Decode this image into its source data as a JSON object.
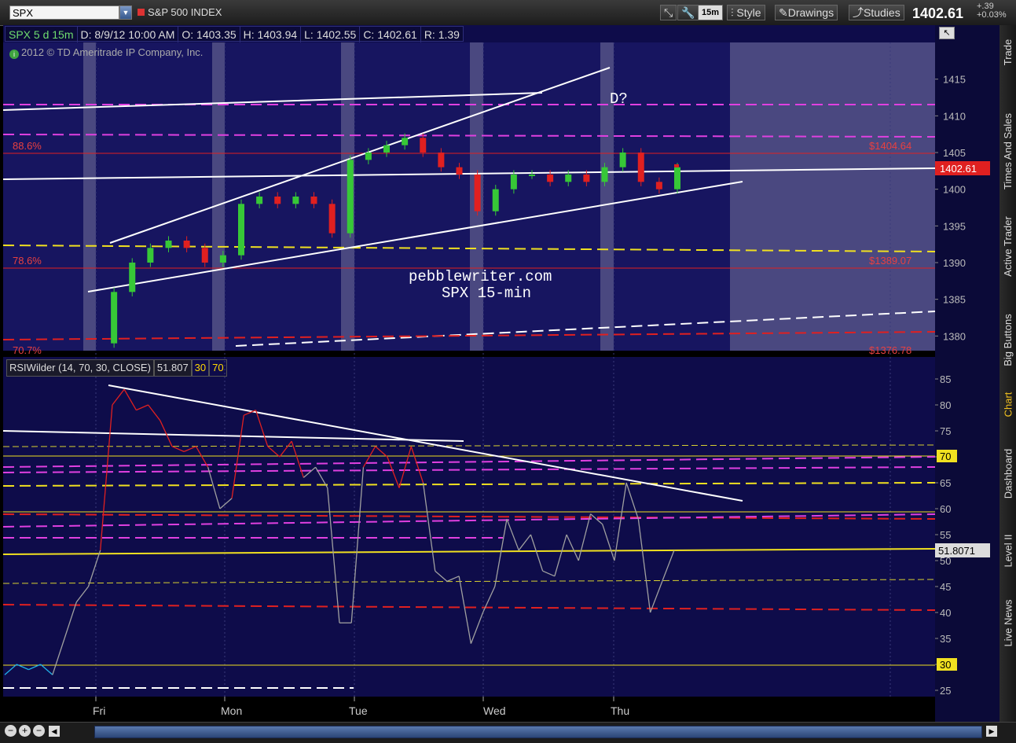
{
  "toolbar": {
    "symbol": "SPX",
    "description": "S&P 500 INDEX",
    "timeframe": "15m",
    "style_label": "Style",
    "drawings_label": "Drawings",
    "studies_label": "Studies",
    "last_price": "1402.61",
    "net_change": "+.39",
    "pct_change": "+0.03%"
  },
  "header": {
    "symbol_period": "SPX 5 d 15m",
    "date": "D: 8/9/12 10:00 AM",
    "open": "O: 1403.35",
    "high": "H: 1403.94",
    "low": "L: 1402.55",
    "close": "C: 1402.61",
    "range": "R: 1.39"
  },
  "copyright": "2012 © TD Ameritrade IP Company, Inc.",
  "annotations": {
    "d_question": "D?",
    "site": "pebblewriter.com",
    "subtitle": "SPX 15-min",
    "fib_886": "88.6%",
    "fib_786": "78.6%",
    "fib_707": "70.7%",
    "fib_886_price": "$1404.64",
    "fib_786_price": "$1389.07",
    "fib_707_price": "$1376.78"
  },
  "rsi_header": {
    "study": "RSIWilder (14, 70, 30, CLOSE)",
    "value": "51.807",
    "overbought": "30",
    "oversold": "70"
  },
  "price_axis": {
    "ticks": [
      "1415",
      "1410",
      "1405",
      "1400",
      "1395",
      "1390",
      "1385",
      "1380"
    ],
    "current_label": "1402.61"
  },
  "rsi_axis": {
    "ticks": [
      "85",
      "80",
      "75",
      "70",
      "65",
      "60",
      "55",
      "50",
      "45",
      "40",
      "35",
      "30",
      "25"
    ],
    "current_label": "51.8071",
    "level_70_label": "70",
    "level_30_label": "30"
  },
  "x_axis": {
    "days": [
      "Fri",
      "Mon",
      "Tue",
      "Wed",
      "Thu"
    ]
  },
  "side_tabs": [
    "Trade",
    "Times And Sales",
    "Active Trader",
    "Big Buttons",
    "Chart",
    "Dashboard",
    "Level II",
    "Live News"
  ],
  "colors": {
    "chart_bg": "#0e0c4a",
    "session_shade": "#4a4880",
    "up_candle": "#37c837",
    "down_candle": "#e02020",
    "magenta": "#e040e0",
    "yellow": "#f0e020",
    "red": "#e02020",
    "white": "#ffffff"
  },
  "chart_data": [
    {
      "type": "candlestick",
      "title": "SPX 15-min",
      "ylim": [
        1378,
        1420
      ],
      "y_ticks": [
        1415,
        1410,
        1405,
        1400,
        1395,
        1390,
        1385,
        1380
      ],
      "categories": [
        "Fri",
        "Mon",
        "Tue",
        "Wed",
        "Thu"
      ],
      "approx_close_path": [
        1379,
        1386,
        1390,
        1392,
        1393,
        1392,
        1390,
        1391,
        1398,
        1399,
        1398,
        1399,
        1398,
        1394,
        1404,
        1405,
        1406,
        1407,
        1405,
        1403,
        1402,
        1397,
        1400,
        1402,
        1402,
        1401,
        1402,
        1401,
        1403,
        1405,
        1401,
        1400,
        1403
      ],
      "last": 1402.61,
      "fib_levels": [
        {
          "name": "88.6%",
          "value": 1404.64
        },
        {
          "name": "78.6%",
          "value": 1389.07
        },
        {
          "name": "70.7%",
          "value": 1376.78
        }
      ]
    },
    {
      "type": "line",
      "title": "RSIWilder (14, 70, 30, CLOSE)",
      "ylim": [
        25,
        85
      ],
      "y_ticks": [
        85,
        80,
        75,
        70,
        65,
        60,
        55,
        50,
        45,
        40,
        35,
        30,
        25
      ],
      "categories": [
        "Fri",
        "Mon",
        "Tue",
        "Wed",
        "Thu"
      ],
      "approx_values": [
        28,
        30,
        29,
        30,
        28,
        35,
        42,
        45,
        52,
        80,
        83,
        79,
        80,
        77,
        72,
        71,
        72,
        68,
        60,
        62,
        78,
        79,
        72,
        70,
        73,
        66,
        68,
        64,
        38,
        38,
        68,
        72,
        70,
        64,
        72,
        65,
        48,
        46,
        47,
        34,
        40,
        45,
        58,
        52,
        55,
        48,
        47,
        55,
        50,
        59,
        57,
        50,
        65,
        58,
        40,
        46,
        52
      ],
      "last": 51.8071,
      "levels": [
        70,
        30
      ]
    }
  ]
}
